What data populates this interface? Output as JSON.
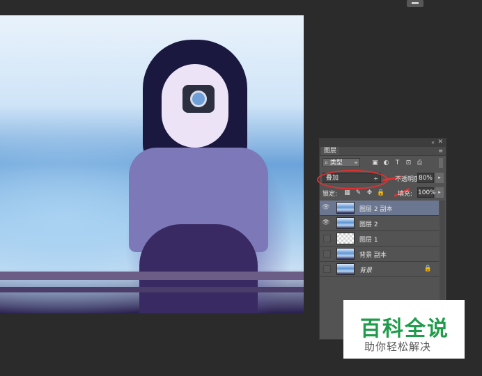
{
  "colors": {
    "accent_red": "#e53030",
    "watermark_green": "#1e9c4a",
    "panel_bg": "#535353",
    "selected_row": "#6b7690"
  },
  "icons": {
    "collapse": "«",
    "close": "✕",
    "panel_menu": "≡",
    "filter_search": "⌕",
    "dropdown_arrow": "÷",
    "filter_pixel": "▣",
    "filter_adjust": "◐",
    "filter_type": "T",
    "filter_shape": "⊡",
    "filter_smart": "⎙",
    "lock_pixels_transparent": "▦",
    "lock_brush": "✎",
    "lock_move": "✥",
    "lock_all": "🔒",
    "eye": "👁",
    "stepper": "▸"
  },
  "panel": {
    "tab_label": "图层",
    "filter": {
      "search_icon": "⌕",
      "kind_value": "类型"
    },
    "blend_mode": {
      "value": "叠加"
    },
    "opacity": {
      "label": "不透明度:",
      "value": "80%"
    },
    "lock": {
      "label": "锁定:"
    },
    "fill": {
      "label": "填充:",
      "value": "100%"
    },
    "layers": [
      {
        "name": "图层 2 副本",
        "visible": true,
        "selected": true,
        "thumb": "photo"
      },
      {
        "name": "图层 2",
        "visible": true,
        "selected": false,
        "thumb": "photo"
      },
      {
        "name": "图层 1",
        "visible": false,
        "selected": false,
        "thumb": "checker"
      },
      {
        "name": "背景 副本",
        "visible": false,
        "selected": false,
        "thumb": "photo"
      },
      {
        "name": "背景",
        "visible": false,
        "selected": false,
        "thumb": "photo",
        "locked": true
      }
    ]
  },
  "watermark": {
    "title": "百科全说",
    "subtitle": "助你轻松解决"
  }
}
